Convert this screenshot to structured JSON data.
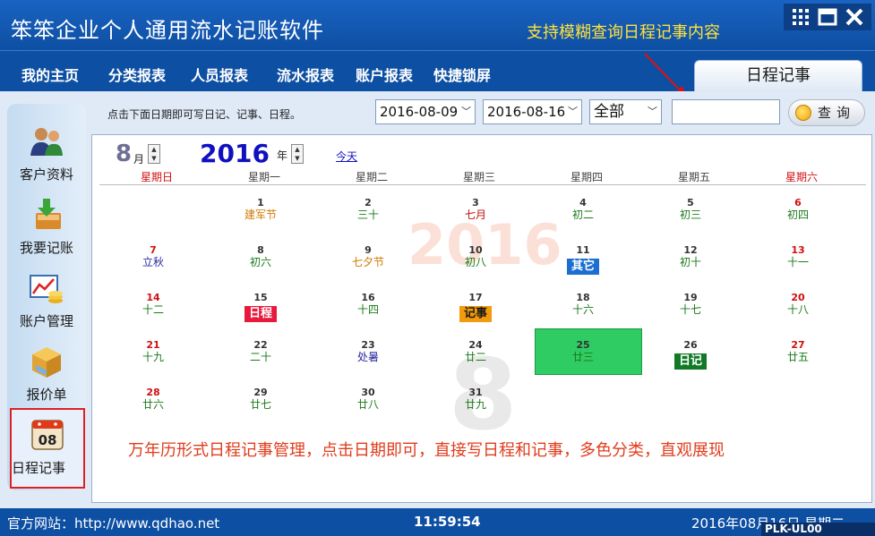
{
  "app": {
    "title": "笨笨企业个人通用流水记账软件",
    "tagline": "支持模糊查询日程记事内容"
  },
  "window_buttons": [
    "grid-icon",
    "maximize-icon",
    "close-icon"
  ],
  "nav": {
    "items": [
      "我的主页",
      "分类报表",
      "人员报表",
      "流水报表",
      "账户报表",
      "快捷锁屏"
    ],
    "active_tab": "日程记事"
  },
  "sidebar": {
    "items": [
      {
        "label": "客户资料",
        "icon": "customers-icon"
      },
      {
        "label": "我要记账",
        "icon": "bookkeeping-icon"
      },
      {
        "label": "账户管理",
        "icon": "account-chart-icon"
      },
      {
        "label": "报价单",
        "icon": "package-icon"
      },
      {
        "label": "日程记事",
        "icon": "calendar-icon",
        "icon_text": "08",
        "active": true
      }
    ]
  },
  "toolbar": {
    "hint": "点击下面日期即可写日记、记事、日程。",
    "start_date": "2016-08-09",
    "end_date": "2016-08-16",
    "category": "全部",
    "search_value": "",
    "query_label": "查询"
  },
  "calendar": {
    "month": "8",
    "month_unit": "月",
    "year": "2016",
    "year_unit": "年",
    "today_link": "今天",
    "weekdays": [
      "星期日",
      "星期一",
      "星期二",
      "星期三",
      "星期四",
      "星期五",
      "星期六"
    ],
    "watermark_year": "2016",
    "watermark_month": "8",
    "days": [
      {
        "day": "1",
        "lunar": "建军节",
        "lunar_style": "fest"
      },
      {
        "day": "2",
        "lunar": "三十"
      },
      {
        "day": "3",
        "lunar": "七月",
        "lunar_style": "red"
      },
      {
        "day": "4",
        "lunar": "初二"
      },
      {
        "day": "5",
        "lunar": "初三"
      },
      {
        "day": "6",
        "lunar": "初四"
      },
      {
        "day": "7",
        "lunar": "立秋",
        "lunar_style": "blue"
      },
      {
        "day": "8",
        "lunar": "初六"
      },
      {
        "day": "9",
        "lunar": "七夕节",
        "lunar_style": "fest"
      },
      {
        "day": "10",
        "lunar": "初八"
      },
      {
        "day": "11",
        "lunar": "",
        "tag": "其它",
        "tag_color": "#1a6fd0"
      },
      {
        "day": "12",
        "lunar": "初十"
      },
      {
        "day": "13",
        "lunar": "十一"
      },
      {
        "day": "14",
        "lunar": "十二"
      },
      {
        "day": "15",
        "lunar": "",
        "tag": "日程",
        "tag_color": "#e8193c"
      },
      {
        "day": "16",
        "lunar": "十四"
      },
      {
        "day": "17",
        "lunar": "",
        "tag": "记事",
        "tag_color": "#f29b0c",
        "tag_text_color": "#1a1a1a"
      },
      {
        "day": "18",
        "lunar": "十六"
      },
      {
        "day": "19",
        "lunar": "十七"
      },
      {
        "day": "20",
        "lunar": "十八"
      },
      {
        "day": "21",
        "lunar": "十九"
      },
      {
        "day": "22",
        "lunar": "二十"
      },
      {
        "day": "23",
        "lunar": "处暑",
        "lunar_style": "blue"
      },
      {
        "day": "24",
        "lunar": "廿二"
      },
      {
        "day": "25",
        "lunar": "廿三",
        "selected": true
      },
      {
        "day": "26",
        "lunar": "",
        "tag": "日记",
        "tag_color": "#127a26"
      },
      {
        "day": "27",
        "lunar": "廿五"
      },
      {
        "day": "28",
        "lunar": "廿六"
      },
      {
        "day": "29",
        "lunar": "廿七"
      },
      {
        "day": "30",
        "lunar": "廿八"
      },
      {
        "day": "31",
        "lunar": "廿九"
      }
    ]
  },
  "promo": "万年历形式日程记事管理，点击日期即可，直接写日程和记事，多色分类，直观展现",
  "status": {
    "website": "官方网站：http://www.qdhao.net",
    "time": "11:59:54",
    "date": "2016年08月16日 星期二",
    "code": "PLK-UL00"
  },
  "colors": {
    "brand": "#0d4fa3",
    "tagline": "#ffe23a",
    "promo": "#e03c1c",
    "selected_day": "#2fcc63"
  }
}
